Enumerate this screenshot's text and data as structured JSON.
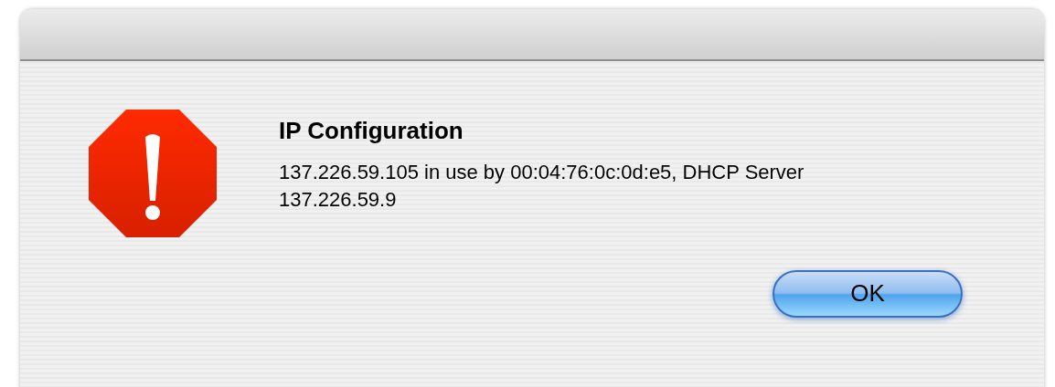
{
  "alert": {
    "title": "IP Configuration",
    "message": "137.226.59.105 in use by 00:04:76:0c:0d:e5, DHCP Server 137.226.59.9",
    "buttons": [
      {
        "label": "OK",
        "default": true
      }
    ]
  }
}
